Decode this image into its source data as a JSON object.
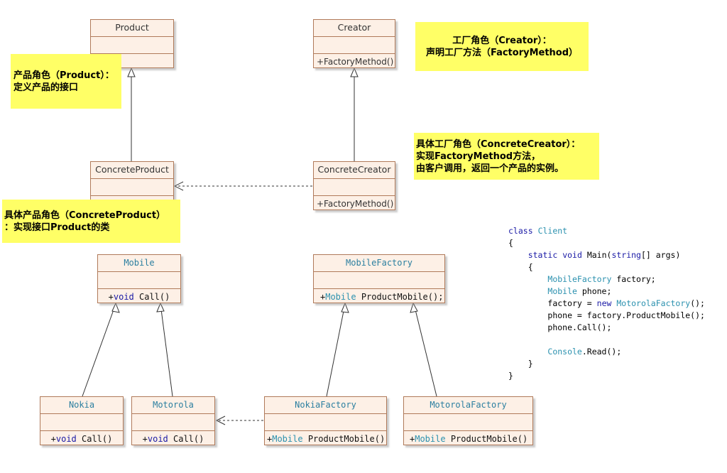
{
  "generic": {
    "product": {
      "name": "Product",
      "op": ""
    },
    "creator": {
      "name": "Creator",
      "op": "+FactoryMethod()"
    },
    "concrete_product": {
      "name": "ConcreteProduct",
      "op": ""
    },
    "concrete_creator": {
      "name": "ConcreteCreator",
      "op": "+FactoryMethod()"
    }
  },
  "notes": {
    "product": {
      "line1": "产品角色（Product）：",
      "line2": "定义产品的接口"
    },
    "creator": {
      "line1": "工厂角色（Creator）：",
      "line2": "声明工厂方法（FactoryMethod）"
    },
    "concrete_creator": {
      "line1": "具体工厂角色（ConcreteCreator）：",
      "line2": "实现FactoryMethod方法，",
      "line3": "由客户调用，返回一个产品的实例。"
    },
    "concrete_product": {
      "line1": "具体产品角色（ConcreteProduct）",
      "line2": "：实现接口Product的类"
    }
  },
  "concrete": {
    "mobile": {
      "name": "Mobile",
      "op_plus": "+",
      "op_type": "void",
      "op_rest": " Call()"
    },
    "mobile_factory": {
      "name": "MobileFactory",
      "op_plus": "+",
      "op_type": "Mobile",
      "op_rest": " ProductMobile();"
    },
    "nokia": {
      "name": "Nokia",
      "op_plus": "+",
      "op_type": "void",
      "op_rest": " Call()"
    },
    "motorola": {
      "name": "Motorola",
      "op_plus": "+",
      "op_type": "void",
      "op_rest": " Call()"
    },
    "nokia_factory": {
      "name": "NokiaFactory",
      "op_plus": "+",
      "op_type": "Mobile",
      "op_rest": " ProductMobile()"
    },
    "motorola_factory": {
      "name": "MotorolaFactory",
      "op_plus": "+",
      "op_type": "Mobile",
      "op_rest": " ProductMobile()"
    }
  },
  "code": {
    "l1_kw": "class",
    "l1_type": "Client",
    "l2": "{",
    "l3_kw1": "static",
    "l3_kw2": "void",
    "l3_rest1": " Main(",
    "l3_kw3": "string",
    "l3_rest2": "[] args)",
    "l4": "{",
    "l5_type": "MobileFactory",
    "l5_rest": " factory;",
    "l6_type": "Mobile",
    "l6_rest": " phone;",
    "l7_a": "factory = ",
    "l7_kw": "new",
    "l7_type": " MotorolaFactory",
    "l7_rest": "();",
    "l8": "phone = factory.ProductMobile();",
    "l9": "phone.Call();",
    "l10_type": "Console",
    "l10_rest": ".Read();",
    "l11": "}",
    "l12": "}"
  }
}
